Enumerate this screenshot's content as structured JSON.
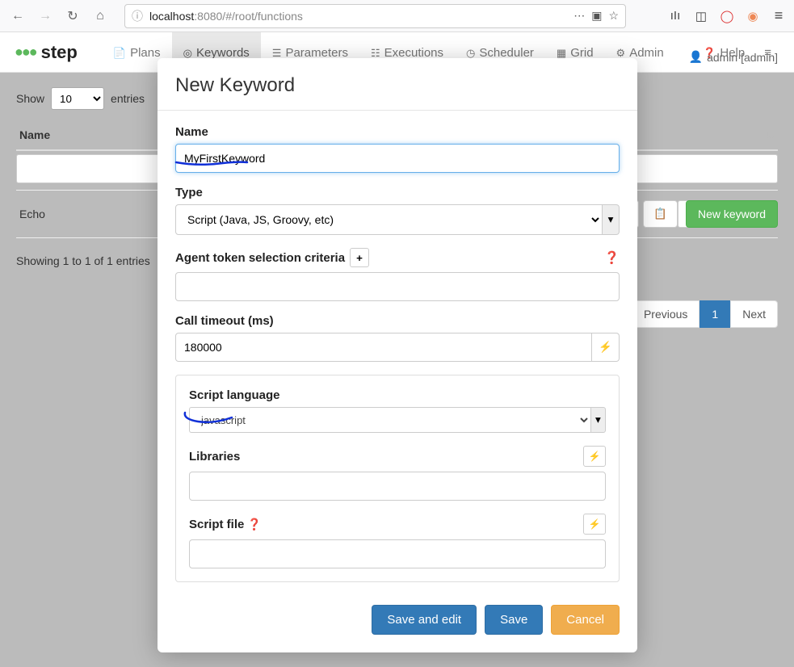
{
  "browser": {
    "host": "localhost",
    "port_path": ":8080/#/root/functions"
  },
  "app": {
    "logo_text": "step",
    "tabs": {
      "plans": "Plans",
      "keywords": "Keywords",
      "parameters": "Parameters",
      "executions": "Executions",
      "scheduler": "Scheduler",
      "grid": "Grid",
      "admin": "Admin",
      "help": "Help"
    },
    "user_label": "admin [admin]"
  },
  "listing": {
    "show_label": "Show",
    "entries_label": "entries",
    "entries_value": "10",
    "name_header": "Name",
    "row_name": "Echo",
    "showing_text": "Showing 1 to 1 of 1 entries",
    "new_keyword_btn": "New keyword",
    "prev": "Previous",
    "page": "1",
    "next": "Next"
  },
  "modal": {
    "title": "New Keyword",
    "name_label": "Name",
    "name_value": "MyFirstKeyword",
    "type_label": "Type",
    "type_value": "Script (Java, JS, Groovy, etc)",
    "agent_label": "Agent token selection criteria",
    "timeout_label": "Call timeout (ms)",
    "timeout_value": "180000",
    "script_lang_label": "Script language",
    "script_lang_value": "javascript",
    "libraries_label": "Libraries",
    "script_file_label": "Script file",
    "save_edit": "Save and edit",
    "save": "Save",
    "cancel": "Cancel"
  }
}
